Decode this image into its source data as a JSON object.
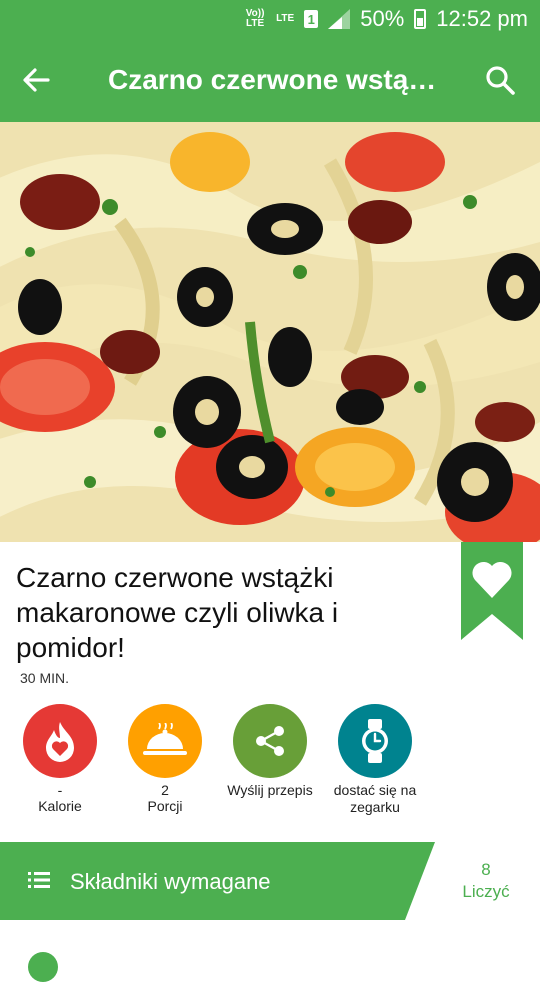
{
  "status_bar": {
    "volte": "Vo)) LTE",
    "lte": "LTE",
    "sim": "1",
    "battery": "50%",
    "time": "12:52 pm"
  },
  "appbar": {
    "title": "Czarno czerwone wstą…",
    "back_icon": "arrow-left-icon",
    "search_icon": "search-icon"
  },
  "recipe": {
    "title": "Czarno czerwone wstążki makaronowe czyli oliwka i pomidor!",
    "time": "30 MIN."
  },
  "actions": [
    {
      "value": "-",
      "label": "Kalorie",
      "color": "#e53935",
      "icon": "flame-heart-icon"
    },
    {
      "value": "2",
      "label": "Porcji",
      "color": "#ffa000",
      "icon": "serving-dish-icon"
    },
    {
      "value": "",
      "label": "Wyślij przepis",
      "color": "#689f38",
      "icon": "share-icon"
    },
    {
      "value": "",
      "label": "dostać się na zegarku",
      "color": "#00838f",
      "icon": "watch-icon"
    }
  ],
  "ingredients": {
    "label": "Składniki wymagane",
    "count": "8",
    "count_label": "Liczyć"
  },
  "colors": {
    "primary": "#4caf50"
  }
}
